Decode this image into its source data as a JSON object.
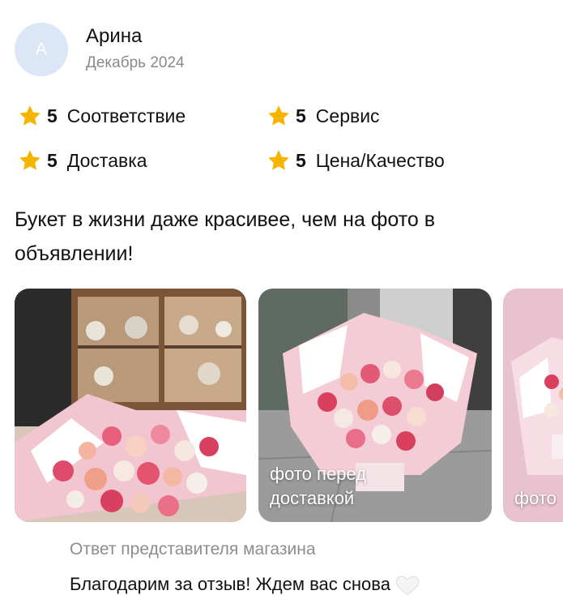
{
  "author": {
    "initial": "А",
    "name": "Арина",
    "date": "Декабрь 2024"
  },
  "ratings": [
    {
      "score": "5",
      "label": "Соответствие"
    },
    {
      "score": "5",
      "label": "Сервис"
    },
    {
      "score": "5",
      "label": "Доставка"
    },
    {
      "score": "5",
      "label": "Цена/Качество"
    }
  ],
  "review": {
    "text": "Букет в жизни даже красивее, чем на фото в объявлении!"
  },
  "photos": [
    {
      "caption": ""
    },
    {
      "caption": "фото перед доставкой"
    },
    {
      "caption": "фото"
    }
  ],
  "reply": {
    "title": "Ответ представителя магазина",
    "text": "Благодарим за отзыв! Ждем вас снова"
  },
  "icons": {
    "star": "star-icon",
    "heart": "white-heart-icon"
  },
  "colors": {
    "star": "#f5b400",
    "avatar_bg": "#dbe6f7",
    "muted_text": "#8a8a8a"
  }
}
